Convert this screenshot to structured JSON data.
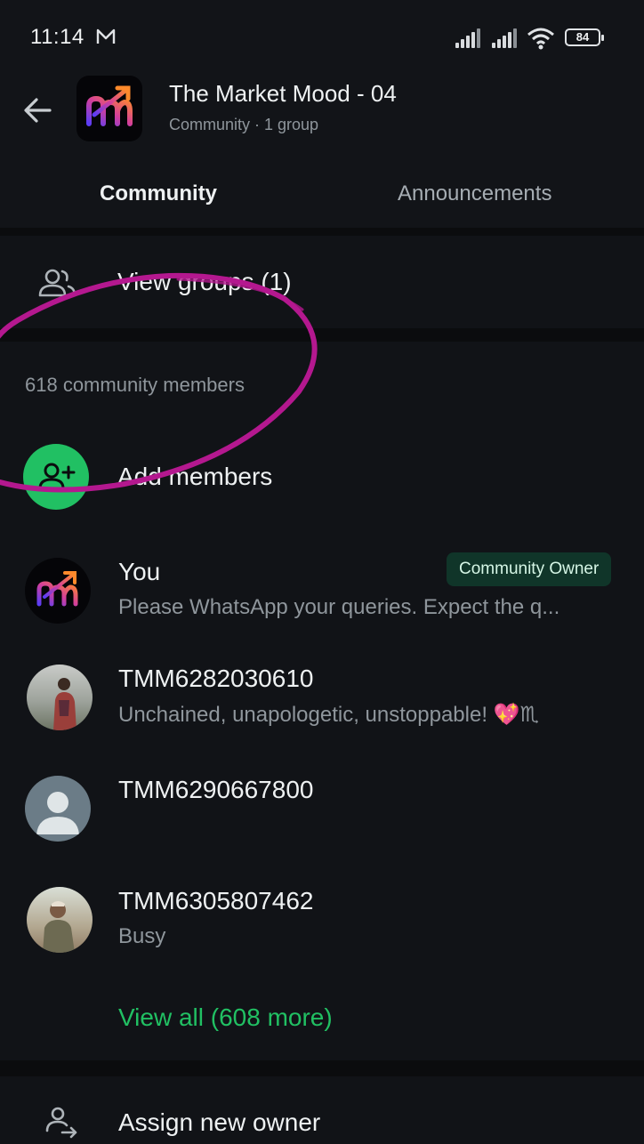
{
  "status_bar": {
    "time": "11:14",
    "battery": "84",
    "icons": [
      "mail-icon",
      "signal-icon",
      "signal-icon",
      "wifi-icon",
      "battery-icon"
    ]
  },
  "header": {
    "title": "The Market Mood - 04",
    "subtitle": "Community · 1 group",
    "logo_icon": "community-logo",
    "tabs": [
      {
        "label": "Community",
        "active": true
      },
      {
        "label": "Announcements",
        "active": false
      }
    ]
  },
  "groups": {
    "label": "View groups (1)",
    "icon": "groups-icon"
  },
  "members": {
    "count_label": "618 community members",
    "add_label": "Add members",
    "list": [
      {
        "name": "You",
        "status": "Please WhatsApp your queries. Expect the q...",
        "badge": "Community Owner"
      },
      {
        "name": "TMM6282030610",
        "status": "Unchained, unapologetic, unstoppable! 💖♏"
      },
      {
        "name": "TMM6290667800",
        "status": ""
      },
      {
        "name": "TMM6305807462",
        "status": "Busy"
      }
    ],
    "view_all": "View all (608 more)"
  },
  "assign": {
    "label": "Assign new owner",
    "icon": "assign-owner-icon"
  },
  "colors": {
    "accent": "#21c063",
    "annotation": "#b4188f",
    "background": "#0b0c0e"
  }
}
